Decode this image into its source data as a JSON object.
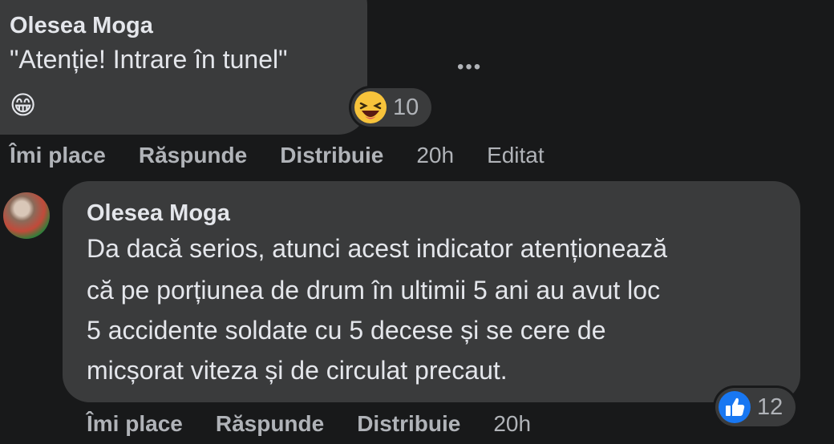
{
  "comment1": {
    "author": "Olesea Moga",
    "text": "\"Atenție! Intrare în tunel\"",
    "emoji": "😁",
    "reaction": {
      "icon": "laughing-face-icon",
      "count": "10"
    },
    "actions": {
      "like": "Îmi place",
      "reply": "Răspunde",
      "share": "Distribuie",
      "time": "20h",
      "edited": "Editat"
    }
  },
  "comment2": {
    "author": "Olesea Moga",
    "lines": [
      "Da dacă serios, atunci acest indicator atenționează",
      "că pe porțiunea de drum în ultimii 5 ani au avut loc",
      "5 accidente soldate cu 5 decese și se cere de",
      "micșorat viteza și de circulat precaut."
    ],
    "reaction": {
      "icon": "thumbs-up-icon",
      "count": "12"
    },
    "actions": {
      "like": "Îmi place",
      "reply": "Răspunde",
      "share": "Distribuie",
      "time": "20h"
    }
  },
  "colors": {
    "background": "#18191a",
    "bubble": "#3a3b3c",
    "text": "#e4e6eb",
    "secondary": "#b0b3b8",
    "like_blue": "#1877f2"
  }
}
